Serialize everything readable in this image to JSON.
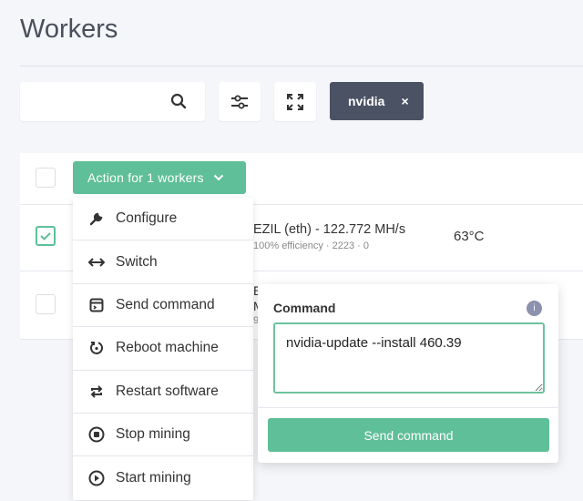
{
  "page": {
    "title": "Workers"
  },
  "toolbar": {
    "search_placeholder": "",
    "search_icon": "search-icon",
    "filter_icon": "sliders-icon",
    "expand_icon": "expand-icon",
    "filter_chip": {
      "label": "nvidia",
      "remove": "×"
    }
  },
  "table": {
    "action_button": "Action for 1 workers",
    "rows": [
      {
        "selected": true,
        "pool": "EZIL (eth) - 122.772 MH/s",
        "sub": "100% efficiency · 2223 · 0",
        "temp": "63°C"
      },
      {
        "selected": false,
        "frag1": "E",
        "frag2": "M",
        "frag3": "9"
      }
    ]
  },
  "menu": {
    "items": [
      {
        "label": "Configure",
        "icon": "wrench-icon"
      },
      {
        "label": "Switch",
        "icon": "arrows-horizontal-icon"
      },
      {
        "label": "Send command",
        "icon": "terminal-icon"
      },
      {
        "label": "Reboot machine",
        "icon": "reboot-icon"
      },
      {
        "label": "Restart software",
        "icon": "restart-icon"
      },
      {
        "label": "Stop mining",
        "icon": "stop-icon"
      },
      {
        "label": "Start mining",
        "icon": "play-icon"
      }
    ]
  },
  "command_popover": {
    "label": "Command",
    "info": "i",
    "value": "nvidia-update --install 460.39",
    "submit": "Send command"
  },
  "colors": {
    "accent": "#5fbf98",
    "chip": "#4b5263",
    "info": "#8c91ad"
  }
}
